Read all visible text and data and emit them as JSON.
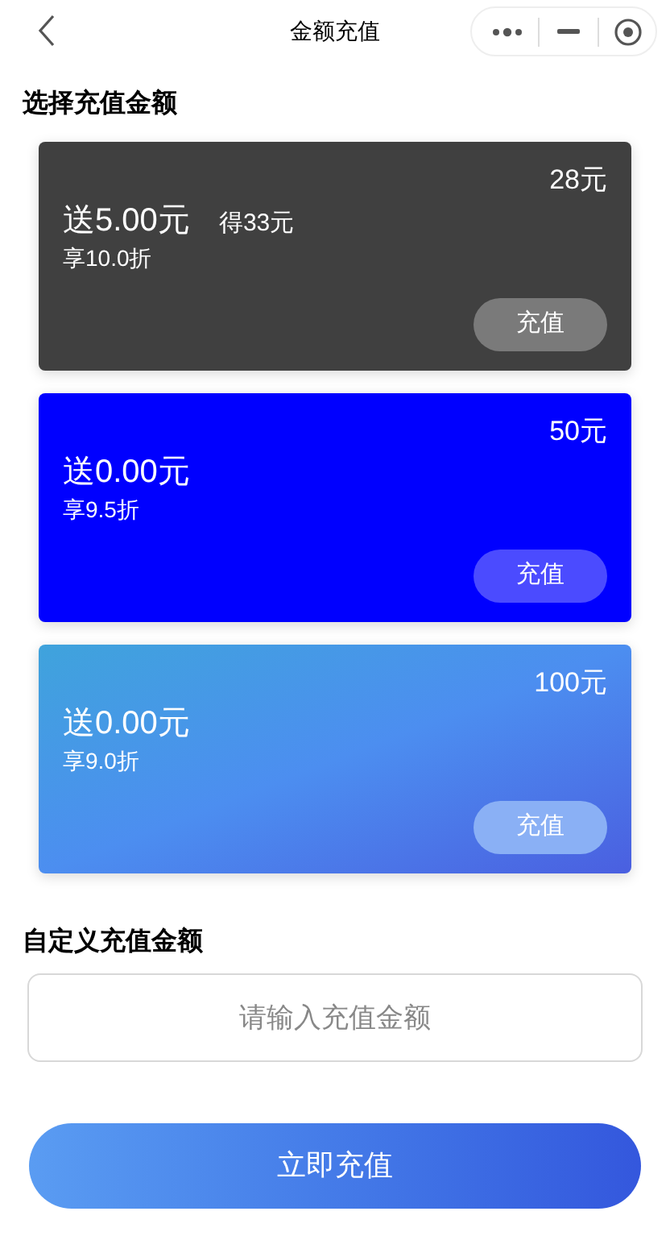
{
  "nav": {
    "title": "金额充值"
  },
  "section_title": "选择充值金额",
  "cards": [
    {
      "kind": "dark",
      "price": "28元",
      "bonus": "送5.00元",
      "total": "得33元",
      "discount": "享10.0折",
      "button": "充值"
    },
    {
      "kind": "blue",
      "price": "50元",
      "bonus": "送0.00元",
      "discount": "享9.5折",
      "button": "充值"
    },
    {
      "kind": "gradient",
      "price": "100元",
      "bonus": "送0.00元",
      "discount": "享9.0折",
      "button": "充值"
    }
  ],
  "custom": {
    "title": "自定义充值金额",
    "placeholder": "请输入充值金额"
  },
  "submit": "立即充值"
}
